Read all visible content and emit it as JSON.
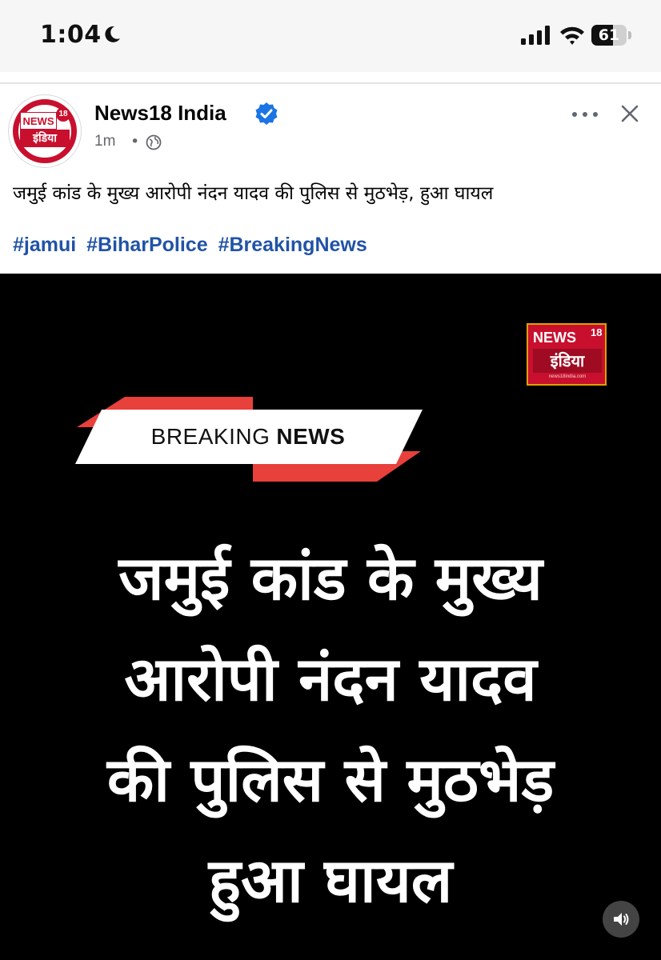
{
  "status_bar": {
    "time": "1:04",
    "battery_level": "61",
    "battery_fraction": 0.61,
    "icons": [
      "moon-icon",
      "signal-icon",
      "wifi-icon",
      "battery-icon"
    ]
  },
  "post": {
    "page_name": "News18 India",
    "verified": true,
    "time_ago": "1m",
    "separator": "•",
    "audience_icon": "globe-icon",
    "avatar": {
      "news": "NEWS",
      "number": "18",
      "india": "इंडिया"
    },
    "caption": "जमुई कांड के मुख्य आरोपी नंदन यादव की पुलिस से मुठभेड़, हुआ घायल",
    "hashtags": [
      "#jamui",
      "#BiharPolice",
      "#BreakingNews"
    ]
  },
  "image": {
    "logo": {
      "news": "NEWS",
      "number": "18",
      "india": "इंडिया",
      "url": "news18india.com"
    },
    "banner": {
      "light": "BREAKING",
      "bold": "NEWS"
    },
    "headline_lines": [
      "जमुई कांड के मुख्य",
      "आरोपी नंदन यादव",
      "की पुलिस से मुठभेड़",
      "हुआ घायल"
    ]
  },
  "colors": {
    "brand_red": "#c8102e",
    "banner_red": "#e8403b",
    "hashtag_blue": "#2153a6",
    "verified_blue": "#1b74e4"
  }
}
